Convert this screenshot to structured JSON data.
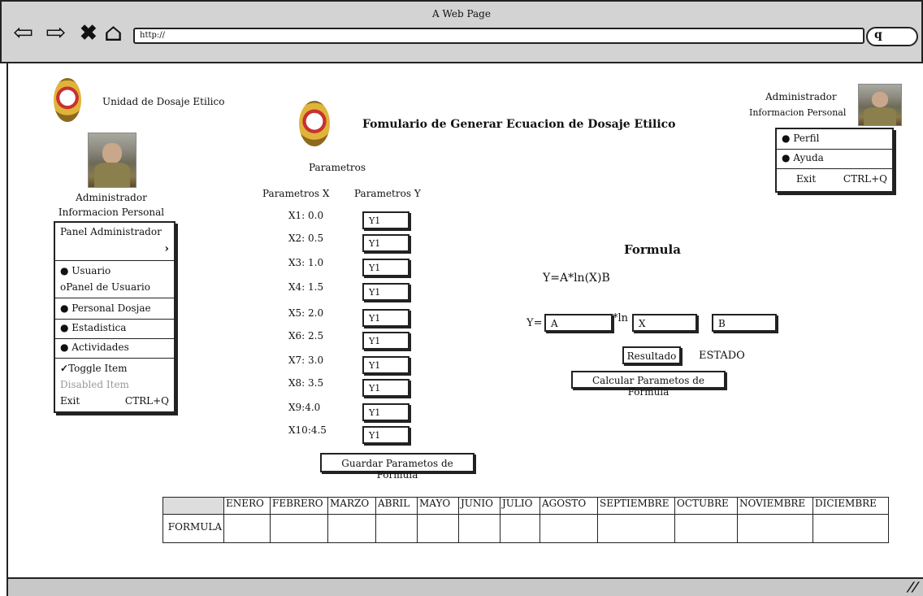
{
  "window": {
    "title": "A Web Page",
    "url": "http://"
  },
  "brand": {
    "name": "Unidad de Dosaje Etilico"
  },
  "page": {
    "title": "Fomulario de Generar Ecuacion de Dosaje Etilico"
  },
  "user_top": {
    "line1": "Administrador",
    "line2": "Informacion Personal"
  },
  "user_menu": {
    "items": [
      "Perfil",
      "Ayuda"
    ],
    "exit": "Exit",
    "exit_shortcut": "CTRL+Q"
  },
  "user_left": {
    "line1": "Administrador",
    "line2": "Informacion Personal"
  },
  "side_menu": {
    "panel": "Panel Administrador",
    "usuario": "Usuario",
    "panel_usuario": "oPanel de Usuario",
    "personal": "Personal Dosjae",
    "estadistica": "Estadistica",
    "actividades": "Actividades",
    "toggle": "Toggle Item",
    "disabled": "Disabled Item",
    "exit": "Exit",
    "exit_shortcut": "CTRL+Q"
  },
  "params": {
    "title": "Parametros",
    "x_header": "Parametros X",
    "y_header": "Parametros Y",
    "rows": [
      {
        "x": "X1: 0.0",
        "y": "Y1"
      },
      {
        "x": "X2: 0.5",
        "y": "Y1"
      },
      {
        "x": "X3: 1.0",
        "y": "Y1"
      },
      {
        "x": "X4: 1.5",
        "y": "Y1"
      },
      {
        "x": "X5: 2.0",
        "y": "Y1"
      },
      {
        "x": "X6: 2.5",
        "y": "Y1"
      },
      {
        "x": "X7: 3.0",
        "y": "Y1"
      },
      {
        "x": "X8: 3.5",
        "y": "Y1"
      },
      {
        "x": "X9:4.0",
        "y": "Y1"
      },
      {
        "x": "X10:4.5",
        "y": "Y1"
      }
    ],
    "save_button": "Guardar Parametos de Formula"
  },
  "formula": {
    "title": "Formula",
    "expression": "Y=A*ln(X)B",
    "y_label": "Y=",
    "a_value": "A",
    "ln_label": "*ln",
    "x_value": "X",
    "b_value": "B",
    "result_button": "Resultado",
    "status": "ESTADO",
    "calc_button": "Calcular Parametos de Formula"
  },
  "table": {
    "row_label": "FORMULA",
    "months": [
      "ENERO",
      "FEBRERO",
      "MARZO",
      "ABRIL",
      "MAYO",
      "JUNIO",
      "JULIO",
      "AGOSTO",
      "SEPTIEMBRE",
      "OCTUBRE",
      "NOVIEMBRE",
      "DICIEMBRE"
    ]
  }
}
